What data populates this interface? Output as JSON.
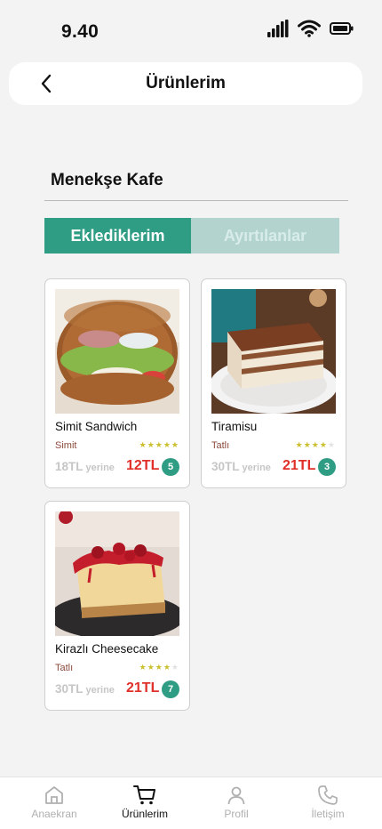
{
  "status_bar": {
    "time": "9.40"
  },
  "header": {
    "title": "Ürünlerim",
    "back_icon": "chevron-left-icon"
  },
  "store": {
    "name": "Menekşe Kafe"
  },
  "tabs": [
    {
      "label": "Eklediklerim",
      "active": true
    },
    {
      "label": "Ayırtılanlar",
      "active": false
    }
  ],
  "products": [
    {
      "name": "Simit Sandwich",
      "category": "Simit",
      "rating": 5,
      "old_price": "18TL",
      "old_suffix": "yerine",
      "new_price": "12TL",
      "count": "5"
    },
    {
      "name": "Tiramisu",
      "category": "Tatlı",
      "rating": 4,
      "old_price": "30TL",
      "old_suffix": "yerine",
      "new_price": "21TL",
      "count": "3"
    },
    {
      "name": "Kirazlı Cheesecake",
      "category": "Tatlı",
      "rating": 4,
      "old_price": "30TL",
      "old_suffix": "yerine",
      "new_price": "21TL",
      "count": "7"
    }
  ],
  "bottom_nav": [
    {
      "label": "Anaekran",
      "icon": "home-icon",
      "active": false
    },
    {
      "label": "Ürünlerim",
      "icon": "cart-icon",
      "active": true
    },
    {
      "label": "Profil",
      "icon": "user-icon",
      "active": false
    },
    {
      "label": "İletişim",
      "icon": "phone-icon",
      "active": false
    }
  ],
  "colors": {
    "accent": "#2f9c84",
    "price_red": "#e0302a",
    "tab_inactive": "#b3d4ce"
  }
}
